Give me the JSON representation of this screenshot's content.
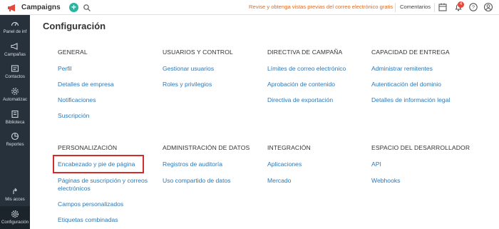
{
  "app": {
    "name": "Campaigns"
  },
  "topbar": {
    "promo": "Revise y obtenga vistas previas del correo electrónico gratis",
    "comments": "Comentarios",
    "notifications_count": "4"
  },
  "sidebar": {
    "items": [
      {
        "label": "Panel de inf",
        "icon": "dashboard-icon"
      },
      {
        "label": "Campañas",
        "icon": "megaphone-icon"
      },
      {
        "label": "Contactos",
        "icon": "contacts-icon"
      },
      {
        "label": "Automatizac",
        "icon": "automation-icon"
      },
      {
        "label": "Biblioteca",
        "icon": "library-icon"
      },
      {
        "label": "Reportes",
        "icon": "reports-icon"
      },
      {
        "label": "Mis acces",
        "icon": "shortcut-icon"
      },
      {
        "label": "Configuración",
        "icon": "gear-icon"
      }
    ]
  },
  "page": {
    "title": "Configuración"
  },
  "sections": {
    "general": {
      "title": "GENERAL",
      "links": [
        "Perfil",
        "Detalles de empresa",
        "Notificaciones",
        "Suscripción"
      ]
    },
    "users": {
      "title": "USUARIOS Y CONTROL",
      "links": [
        "Gestionar usuarios",
        "Roles y privilegios"
      ]
    },
    "campaign_policy": {
      "title": "DIRECTIVA DE CAMPAÑA",
      "links": [
        "Límites de correo electrónico",
        "Aprobación de contenido",
        "Directiva de exportación"
      ]
    },
    "deliverability": {
      "title": "CAPACIDAD DE ENTREGA",
      "links": [
        "Administrar remitentes",
        "Autenticación del dominio",
        "Detalles de información legal"
      ]
    },
    "personalization": {
      "title": "PERSONALIZACIÓN",
      "links": [
        "Encabezado y pie de página",
        "Páginas de suscripción y correos",
        "electrónicos",
        "Campos personalizados",
        "Etiquetas combinadas"
      ]
    },
    "data_admin": {
      "title": "ADMINISTRACIÓN DE DATOS",
      "links": [
        "Registros de auditoría",
        "Uso compartido de datos"
      ]
    },
    "integration": {
      "title": "INTEGRACIÓN",
      "links": [
        "Aplicaciones",
        "Mercado"
      ]
    },
    "developer": {
      "title": "ESPACIO DEL DESARROLLADOR",
      "links": [
        "API",
        "Webhooks"
      ]
    }
  },
  "colors": {
    "accent_link": "#2b78b8",
    "promo": "#e36b1f",
    "sidebar_bg": "#26313c",
    "highlight": "#d62b2b",
    "plus_button": "#2bb3a0"
  }
}
